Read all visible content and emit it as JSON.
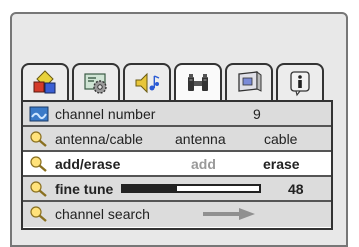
{
  "tabs": [
    {
      "icon": "shapes-icon",
      "active": false
    },
    {
      "icon": "settings-gear-icon",
      "active": false
    },
    {
      "icon": "speaker-music-icon",
      "active": false
    },
    {
      "icon": "binoculars-icon",
      "active": true
    },
    {
      "icon": "monitor-icon",
      "active": false
    },
    {
      "icon": "info-icon",
      "active": false
    }
  ],
  "rows": {
    "channel_number": {
      "label": "channel number",
      "value": "9"
    },
    "antenna_cable": {
      "label": "antenna/cable",
      "option_a": "antenna",
      "option_b": "cable"
    },
    "add_erase": {
      "label": "add/erase",
      "option_a": "add",
      "option_b": "erase"
    },
    "fine_tune": {
      "label": "fine tune",
      "value": "48",
      "level": 0.4
    },
    "channel_search": {
      "label": "channel search"
    }
  },
  "colors": {
    "frame_bg": "#e8e8e8",
    "row_bg": "#dcdcdc",
    "highlight_bg": "#ffffff",
    "arrow": "#909090"
  }
}
